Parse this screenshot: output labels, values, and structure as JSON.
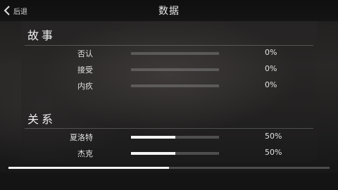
{
  "header": {
    "back_label": "后退",
    "title": "数据"
  },
  "sections": [
    {
      "title": "故事",
      "rows": [
        {
          "label": "否认",
          "value": 0,
          "percent_text": "0%"
        },
        {
          "label": "接受",
          "value": 0,
          "percent_text": "0%"
        },
        {
          "label": "内疚",
          "value": 0,
          "percent_text": "0%"
        }
      ]
    },
    {
      "title": "关系",
      "rows": [
        {
          "label": "夏洛特",
          "value": 0.5,
          "percent_text": "50%"
        },
        {
          "label": "杰克",
          "value": 0.5,
          "percent_text": "50%"
        }
      ]
    }
  ],
  "scrollbar": {
    "position": 0.5
  },
  "colors": {
    "bar_fill": "#f4f4f4",
    "bar_track": "#8c8c8c",
    "text": "#e2e2e2"
  }
}
